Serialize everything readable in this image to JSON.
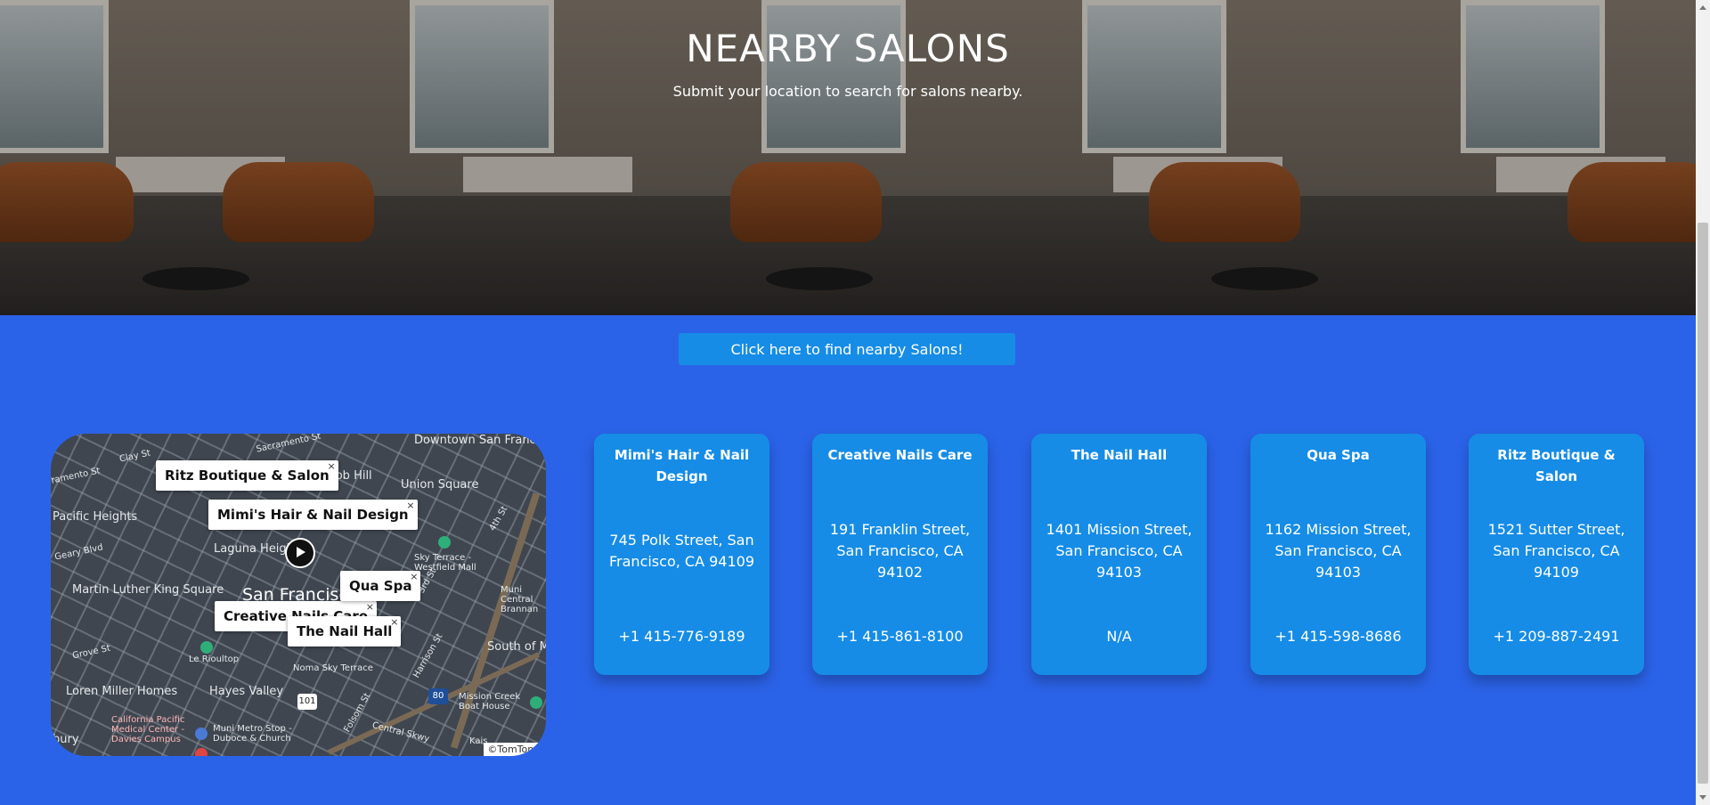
{
  "hero": {
    "title": "NEARBY SALONS",
    "subtitle": "Submit your location to search for salons nearby."
  },
  "find_button": {
    "label": "Click here to find nearby Salons!"
  },
  "map": {
    "labels": {
      "downtown": "Downtown San Francisco",
      "sacramento": "Sacramento St",
      "clay": "Clay St",
      "sacramento_w": "ramento St",
      "nob_hill": "Nob Hill",
      "union_square": "Union Square",
      "pacific_heights": "Pacific Heights",
      "laguna_heights": "Laguna Heights",
      "geary": "Geary Blvd",
      "mlk_square": "Martin Luther King Square",
      "san_francisco": "San Francisco",
      "sky_terrace": "Sky Terrace - Westfield Mall",
      "muni_brannan": "Muni Central Brannan",
      "grove": "Grove St",
      "le_rioultop": "Le Rioultop",
      "south_of_ma": "South of Ma",
      "loren_miller": "Loren Miller Homes",
      "hayes_valley": "Hayes Valley",
      "noma_sky": "Noma Sky Terrace",
      "mission_creek": "Mission Creek Boat House",
      "cpmc": "California Pacific Medical Center - Davies Campus",
      "muni_metro": "Muni Metro Stop - Duboce & Church",
      "central_skwy": "Central Skwy",
      "bury": "bury",
      "folsom": "Folsom St",
      "harrison": "Harrison St",
      "third": "3rd St",
      "fourth": "4th St",
      "hwy101": "101",
      "i80": "80",
      "kaiser": "Kais"
    },
    "popups": {
      "ritz": "Ritz Boutique & Salon",
      "mimis": "Mimi's Hair & Nail Design",
      "qua": "Qua Spa",
      "creative": "Creative Nails Care",
      "nail_hall": "The Nail Hall",
      "close": "×"
    },
    "copyright": "©TomTom"
  },
  "salons": [
    {
      "name": "Mimi's Hair & Nail Design",
      "address": "745 Polk Street, San Francisco, CA 94109",
      "phone": "+1 415-776-9189"
    },
    {
      "name": "Creative Nails Care",
      "address": "191 Franklin Street, San Francisco, CA 94102",
      "phone": "+1 415-861-8100"
    },
    {
      "name": "The Nail Hall",
      "address": "1401 Mission Street, San Francisco, CA 94103",
      "phone": "N/A"
    },
    {
      "name": "Qua Spa",
      "address": "1162 Mission Street, San Francisco, CA 94103",
      "phone": "+1 415-598-8686"
    },
    {
      "name": "Ritz Boutique & Salon",
      "address": "1521 Sutter Street, San Francisco, CA 94109",
      "phone": "+1 209-887-2491"
    }
  ],
  "colors": {
    "page_bg": "#2b63e8",
    "accent": "#168ce6",
    "text": "#ffffff"
  }
}
